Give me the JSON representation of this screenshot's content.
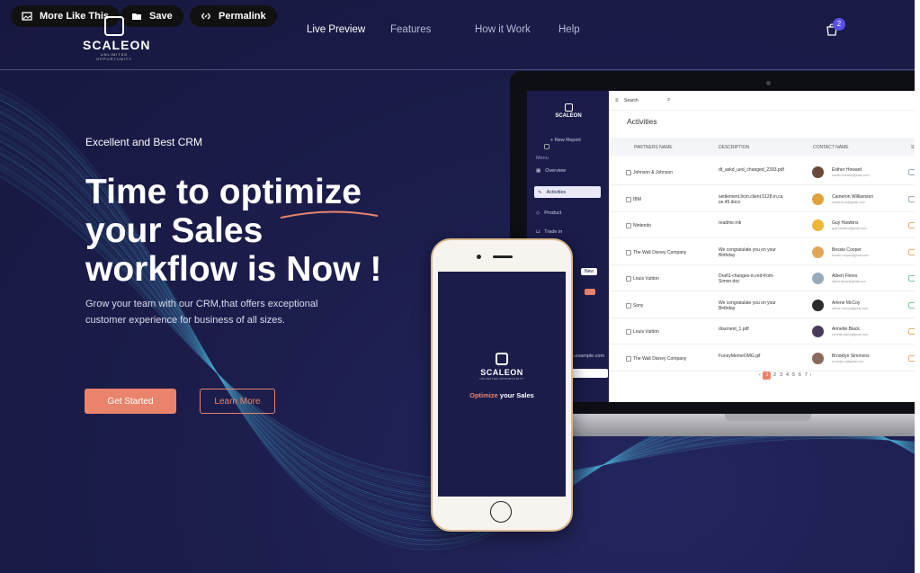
{
  "overlay": {
    "more_like_this": "More Like This",
    "save": "Save",
    "permalink": "Permalink"
  },
  "brand": {
    "name": "SCALEON",
    "tagline": "UNLIMITED OPPORTUNITY"
  },
  "nav": {
    "items": [
      "Live Preview",
      "Features",
      "How it Work",
      "Help"
    ],
    "cart_count": "2"
  },
  "hero": {
    "eyebrow": "Excellent and Best CRM",
    "headline_1": "Time to optimize",
    "headline_2": "your Sales",
    "headline_3": "workflow is Now !",
    "subtext_1": "Grow your team with our CRM,that offers exceptional",
    "subtext_2": "customer experience for business of all sizes.",
    "cta_primary": "Get Started",
    "cta_secondary": "Learn More"
  },
  "dashboard": {
    "search_placeholder": "Search",
    "new_report": "+ New Report",
    "menu_label": "Menu",
    "sidebar": [
      "Overview",
      "Activities",
      "Product",
      "Trade in"
    ],
    "badge_new": "New",
    "email_fragment": "ex.example.com",
    "title": "Activities",
    "columns": [
      "PARTNERS NAME",
      "DESCRIPTION",
      "CONTACT NAME",
      "STA"
    ],
    "rows": [
      {
        "partner": "Johnson & Johnson",
        "desc": "dt_askd_ued_changed_2393.pdf",
        "desc2": "",
        "contact": "Esther Howard",
        "email": "esther.howard@gmail.com",
        "avatar": "#6b4a3a"
      },
      {
        "partner": "IBM",
        "desc": "settlement.hcm.client.5128.in.ca",
        "desc2": "se.45.docx",
        "contact": "Cameron Williamson",
        "email": "cameron.w@gmail.com",
        "avatar": "#e0a23a"
      },
      {
        "partner": "Nintendo",
        "desc": "readme.rnk",
        "desc2": "",
        "contact": "Guy Hawkins",
        "email": "guy.hawkins@gmail.com",
        "avatar": "#f0b63a"
      },
      {
        "partner": "The Walt Disney Company",
        "desc": "We congratulate you on your",
        "desc2": "Birthday",
        "contact": "Bessie Cooper",
        "email": "bessie.cooper@gmail.com",
        "avatar": "#e2a65a"
      },
      {
        "partner": "Louis Vuitton",
        "desc": "Draft1-changes-in,red-from-",
        "desc2": "Simon.doc",
        "contact": "Albert Flores",
        "email": "albert.flores@gmail.com",
        "avatar": "#9ab"
      },
      {
        "partner": "Sony",
        "desc": "We congratulate you on your",
        "desc2": "Birthday",
        "contact": "Arlene McCoy",
        "email": "arlene.mccoy@gmail.com",
        "avatar": "#2b2b2b"
      },
      {
        "partner": "Louis Vuitton",
        "desc": "dournent_1.pdf",
        "desc2": "",
        "contact": "Annette Black",
        "email": "annette.black@gmail.com",
        "avatar": "#4a3a5a"
      },
      {
        "partner": "The Walt Disney Company",
        "desc": "FunnyMemeOMG.gif",
        "desc2": "",
        "contact": "Brooklyn Simmons",
        "email": "brooklyn.s@gmail.com",
        "avatar": "#8a6a5a"
      }
    ],
    "pages": [
      "1",
      "2",
      "3",
      "4",
      "5",
      "6",
      "7"
    ]
  },
  "phone": {
    "tagline_highlight": "Optimize",
    "tagline_rest": " your Sales"
  },
  "colors": {
    "background": "#1b1c4a",
    "accent": "#e9836b",
    "nav_inactive": "#b9bad6",
    "badge": "#5a4fe8"
  }
}
